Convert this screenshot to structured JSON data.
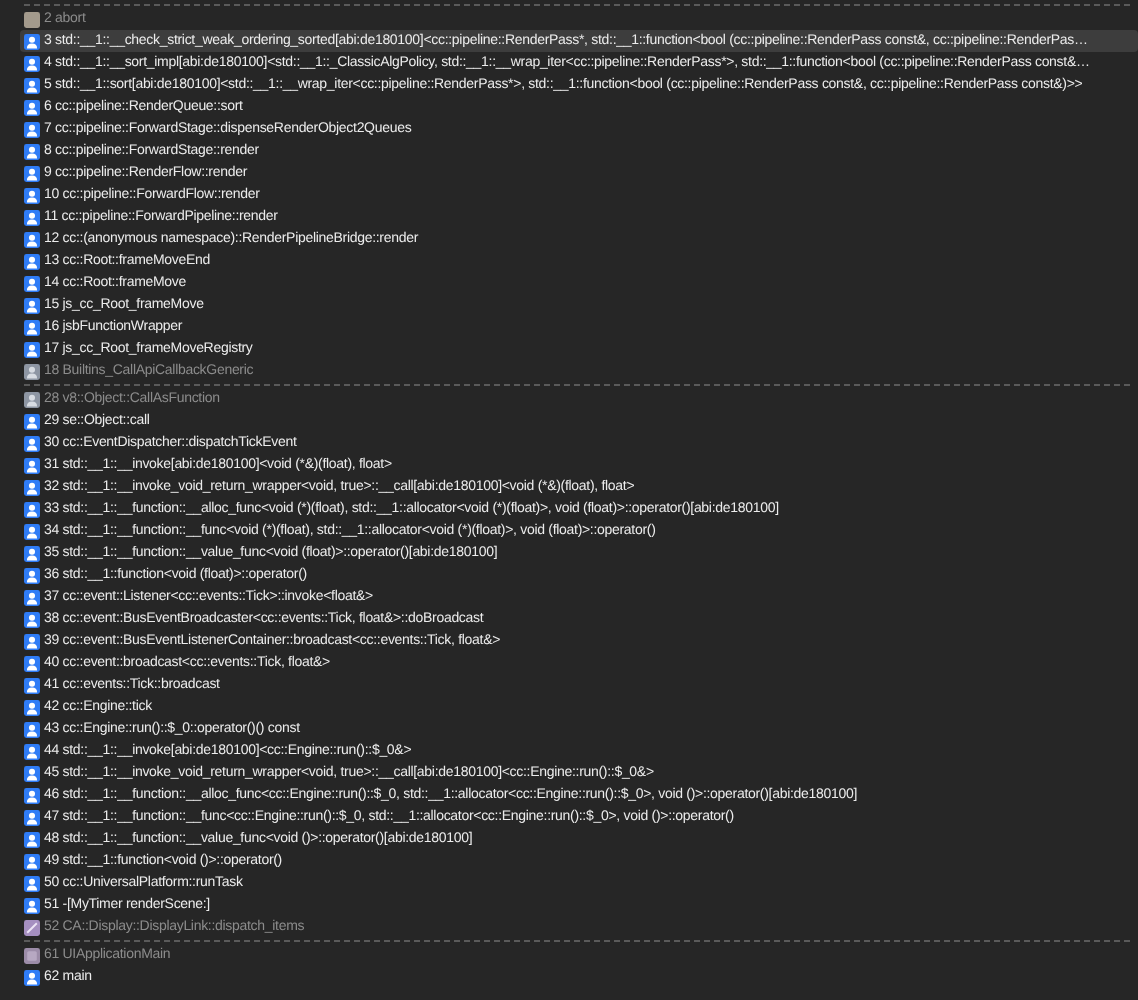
{
  "groups": [
    {
      "frames": [
        {
          "kind": "library",
          "label": "2 abort",
          "selected": false
        },
        {
          "kind": "user",
          "label": "3 std::__1::__check_strict_weak_ordering_sorted[abi:de180100]<cc::pipeline::RenderPass*, std::__1::function<bool (cc::pipeline::RenderPass const&, cc::pipeline::RenderPas…",
          "selected": true
        },
        {
          "kind": "user",
          "label": "4 std::__1::__sort_impl[abi:de180100]<std::__1::_ClassicAlgPolicy, std::__1::__wrap_iter<cc::pipeline::RenderPass*>, std::__1::function<bool (cc::pipeline::RenderPass const&…",
          "selected": false
        },
        {
          "kind": "user",
          "label": "5 std::__1::sort[abi:de180100]<std::__1::__wrap_iter<cc::pipeline::RenderPass*>, std::__1::function<bool (cc::pipeline::RenderPass const&, cc::pipeline::RenderPass const&)>>",
          "selected": false
        },
        {
          "kind": "user",
          "label": "6 cc::pipeline::RenderQueue::sort",
          "selected": false
        },
        {
          "kind": "user",
          "label": "7 cc::pipeline::ForwardStage::dispenseRenderObject2Queues",
          "selected": false
        },
        {
          "kind": "user",
          "label": "8 cc::pipeline::ForwardStage::render",
          "selected": false
        },
        {
          "kind": "user",
          "label": "9 cc::pipeline::RenderFlow::render",
          "selected": false
        },
        {
          "kind": "user",
          "label": "10 cc::pipeline::ForwardFlow::render",
          "selected": false
        },
        {
          "kind": "user",
          "label": "11 cc::pipeline::ForwardPipeline::render",
          "selected": false
        },
        {
          "kind": "user",
          "label": "12 cc::(anonymous namespace)::RenderPipelineBridge::render",
          "selected": false
        },
        {
          "kind": "user",
          "label": "13 cc::Root::frameMoveEnd",
          "selected": false
        },
        {
          "kind": "user",
          "label": "14 cc::Root::frameMove",
          "selected": false
        },
        {
          "kind": "user",
          "label": "15 js_cc_Root_frameMove",
          "selected": false
        },
        {
          "kind": "user",
          "label": "16 jsbFunctionWrapper",
          "selected": false
        },
        {
          "kind": "user",
          "label": "17 js_cc_Root_frameMoveRegistry",
          "selected": false
        },
        {
          "kind": "system",
          "label": "18 Builtins_CallApiCallbackGeneric",
          "selected": false
        }
      ]
    },
    {
      "frames": [
        {
          "kind": "system",
          "label": "28 v8::Object::CallAsFunction",
          "selected": false
        },
        {
          "kind": "user",
          "label": "29 se::Object::call",
          "selected": false
        },
        {
          "kind": "user",
          "label": "30 cc::EventDispatcher::dispatchTickEvent",
          "selected": false
        },
        {
          "kind": "user",
          "label": "31 std::__1::__invoke[abi:de180100]<void (*&)(float), float>",
          "selected": false
        },
        {
          "kind": "user",
          "label": "32 std::__1::__invoke_void_return_wrapper<void, true>::__call[abi:de180100]<void (*&)(float), float>",
          "selected": false
        },
        {
          "kind": "user",
          "label": "33 std::__1::__function::__alloc_func<void (*)(float), std::__1::allocator<void (*)(float)>, void (float)>::operator()[abi:de180100]",
          "selected": false
        },
        {
          "kind": "user",
          "label": "34 std::__1::__function::__func<void (*)(float), std::__1::allocator<void (*)(float)>, void (float)>::operator()",
          "selected": false
        },
        {
          "kind": "user",
          "label": "35 std::__1::__function::__value_func<void (float)>::operator()[abi:de180100]",
          "selected": false
        },
        {
          "kind": "user",
          "label": "36 std::__1::function<void (float)>::operator()",
          "selected": false
        },
        {
          "kind": "user",
          "label": "37 cc::event::Listener<cc::events::Tick>::invoke<float&>",
          "selected": false
        },
        {
          "kind": "user",
          "label": "38 cc::event::BusEventBroadcaster<cc::events::Tick, float&>::doBroadcast",
          "selected": false
        },
        {
          "kind": "user",
          "label": "39 cc::event::BusEventListenerContainer::broadcast<cc::events::Tick, float&>",
          "selected": false
        },
        {
          "kind": "user",
          "label": "40 cc::event::broadcast<cc::events::Tick, float&>",
          "selected": false
        },
        {
          "kind": "user",
          "label": "41 cc::events::Tick::broadcast",
          "selected": false
        },
        {
          "kind": "user",
          "label": "42 cc::Engine::tick",
          "selected": false
        },
        {
          "kind": "user",
          "label": "43 cc::Engine::run()::$_0::operator()() const",
          "selected": false
        },
        {
          "kind": "user",
          "label": "44 std::__1::__invoke[abi:de180100]<cc::Engine::run()::$_0&>",
          "selected": false
        },
        {
          "kind": "user",
          "label": "45 std::__1::__invoke_void_return_wrapper<void, true>::__call[abi:de180100]<cc::Engine::run()::$_0&>",
          "selected": false
        },
        {
          "kind": "user",
          "label": "46 std::__1::__function::__alloc_func<cc::Engine::run()::$_0, std::__1::allocator<cc::Engine::run()::$_0>, void ()>::operator()[abi:de180100]",
          "selected": false
        },
        {
          "kind": "user",
          "label": "47 std::__1::__function::__func<cc::Engine::run()::$_0, std::__1::allocator<cc::Engine::run()::$_0>, void ()>::operator()",
          "selected": false
        },
        {
          "kind": "user",
          "label": "48 std::__1::__function::__value_func<void ()>::operator()[abi:de180100]",
          "selected": false
        },
        {
          "kind": "user",
          "label": "49 std::__1::function<void ()>::operator()",
          "selected": false
        },
        {
          "kind": "user",
          "label": "50 cc::UniversalPlatform::runTask",
          "selected": false
        },
        {
          "kind": "user",
          "label": "51 -[MyTimer renderScene:]",
          "selected": false
        },
        {
          "kind": "animation",
          "label": "52 CA::Display::DisplayLink::dispatch_items",
          "selected": false
        }
      ]
    },
    {
      "frames": [
        {
          "kind": "app",
          "label": "61 UIApplicationMain",
          "selected": false
        },
        {
          "kind": "user",
          "label": "62 main",
          "selected": false
        }
      ]
    }
  ]
}
